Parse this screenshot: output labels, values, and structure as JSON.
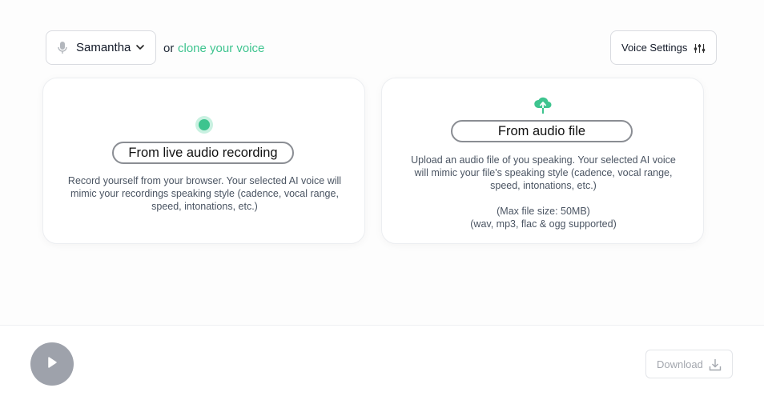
{
  "voice_selector": {
    "selected": "Samantha",
    "icon": "microphone-icon"
  },
  "clone": {
    "or_text": "or",
    "link_text": "clone your voice"
  },
  "settings": {
    "label": "Voice Settings",
    "icon": "sliders-icon"
  },
  "cards": {
    "live": {
      "title": "From live audio recording",
      "description": "Record yourself from your browser. Your selected AI voice will mimic your recordings speaking style (cadence, vocal range, speed, intonations, etc.)"
    },
    "file": {
      "title": "From audio file",
      "description": "Upload an audio file of you speaking. Your selected AI voice will mimic your file's speaking style (cadence, vocal range, speed, intonations, etc.)",
      "max_size": "(Max file size: 50MB)",
      "formats": "(wav, mp3, flac & ogg supported)"
    }
  },
  "player": {
    "download_label": "Download"
  },
  "colors": {
    "accent": "#3ec48f",
    "play_button": "#9ea2ab",
    "border": "#d9dbe0"
  }
}
